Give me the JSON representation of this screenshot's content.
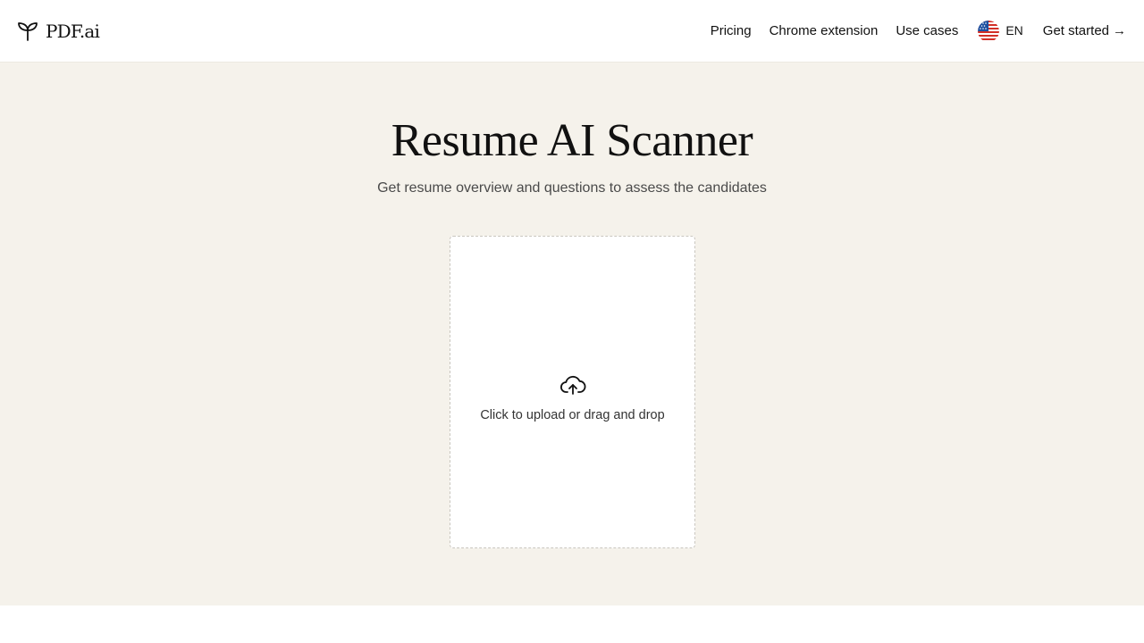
{
  "header": {
    "logo_text": "PDF.ai",
    "nav": [
      {
        "label": "Pricing"
      },
      {
        "label": "Chrome extension"
      },
      {
        "label": "Use cases"
      }
    ],
    "language": {
      "code": "EN",
      "flag_icon": "us-flag-icon"
    },
    "cta": {
      "label": "Get started",
      "arrow": "→"
    }
  },
  "hero": {
    "title": "Resume AI Scanner",
    "subtitle": "Get resume overview and questions to assess the candidates"
  },
  "upload": {
    "text": "Click to upload or drag and drop",
    "icon": "cloud-upload-icon"
  },
  "colors": {
    "hero_background": "#f5f2eb",
    "text": "#111111",
    "subtitle": "#4a4a4a",
    "dropzone_border": "#c9c6bf"
  }
}
